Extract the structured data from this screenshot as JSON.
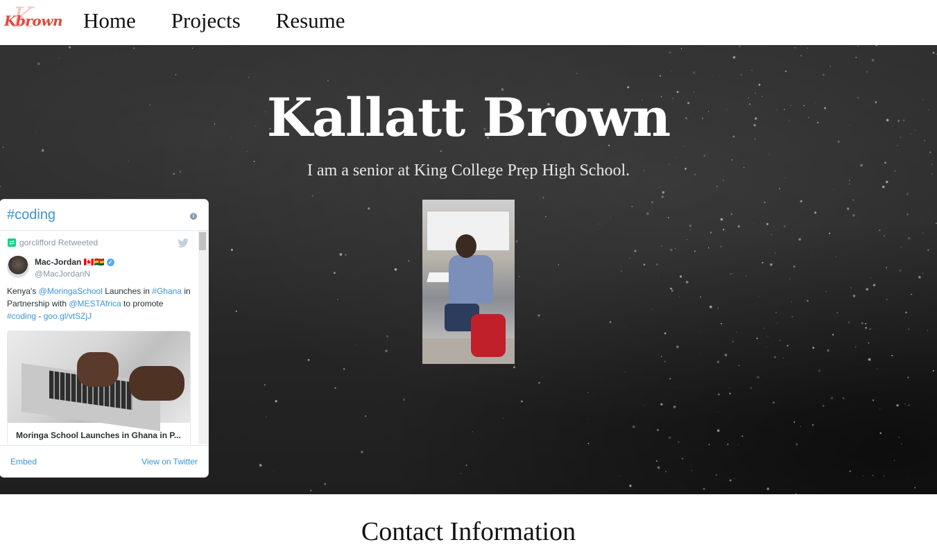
{
  "logo": {
    "text": "Kbrown",
    "mark": "K"
  },
  "nav": {
    "items": [
      "Home",
      "Projects",
      "Resume"
    ]
  },
  "hero": {
    "title": "Kallatt Brown",
    "subtitle": "I am a senior at King College Prep High School."
  },
  "twitter": {
    "title": "#coding",
    "retweet_text": "gorclifford Retweeted",
    "author_name": "Mac-Jordan 🇨🇦🇬🇭",
    "author_handle": "@MacJordanN",
    "tweet": {
      "p1": "Kenya's ",
      "l1": "@MoringaSchool",
      "p2": " Launches in ",
      "l2": "#Ghana",
      "p3": " in Partnership with ",
      "l3": "@MESTAfrica",
      "p4": " to promote ",
      "l4": "#coding",
      "p5": " -  ",
      "l5": "goo.gl/vtSZjJ"
    },
    "card_title": "Moringa School Launches in Ghana in P...",
    "embed_label": "Embed",
    "view_label": "View on Twitter"
  },
  "contact": {
    "heading": "Contact Information"
  },
  "colors": {
    "link": "#3b94d9",
    "retweet": "#19cf86",
    "logo": "#e2483e"
  },
  "icons": [
    "retweet-icon",
    "twitter-bird-icon",
    "info-icon",
    "verified-icon"
  ]
}
